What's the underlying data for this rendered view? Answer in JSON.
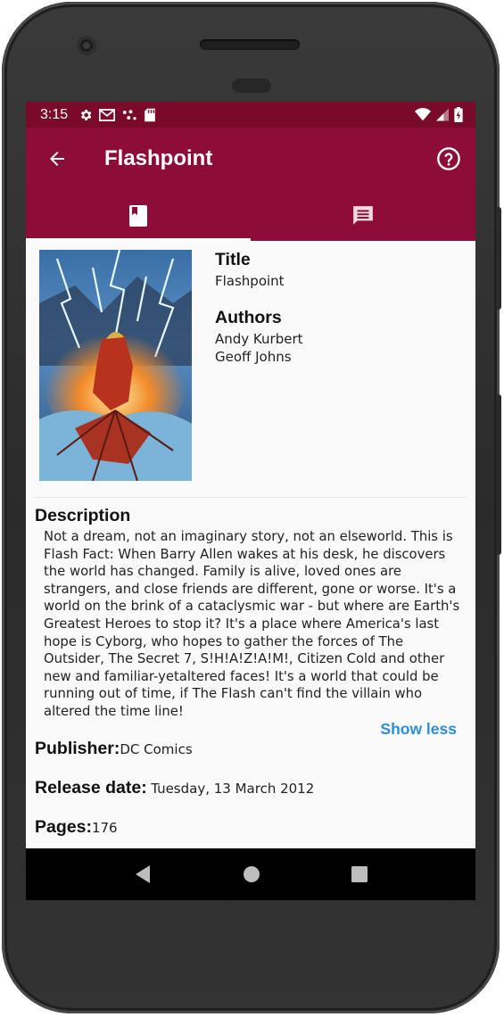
{
  "status_bar": {
    "time": "3:15"
  },
  "app_bar": {
    "title": "Flashpoint"
  },
  "tabs": [
    {
      "name": "details",
      "icon": "book-icon",
      "active": true
    },
    {
      "name": "comments",
      "icon": "comment-icon",
      "active": false
    }
  ],
  "book": {
    "title_label": "Title",
    "title": "Flashpoint",
    "authors_label": "Authors",
    "authors": [
      "Andy Kurbert",
      "Geoff Johns"
    ]
  },
  "description": {
    "label": "Description",
    "text": "Not a dream, not an imaginary story, not an elseworld. This is Flash Fact: When Barry Allen wakes at his desk, he discovers the world has changed. Family is alive, loved ones are strangers, and close friends are different, gone or worse. It's a world on the brink of a cataclysmic war - but where are Earth's Greatest Heroes to stop it? It's a place where America's last hope is Cyborg, who hopes to gather the forces of The Outsider, The Secret 7, S!H!A!Z!A!M!, Citizen Cold and other new and familiar-yetaltered faces! It's a world that could be running out of time, if The Flash can't find the villain who altered the time line!",
    "toggle": "Show less"
  },
  "details": {
    "publisher_label": "Publisher:",
    "publisher": "DC Comics",
    "release_label": "Release date:",
    "release": "Tuesday, 13 March 2012",
    "pages_label": "Pages:",
    "pages": "176"
  },
  "colors": {
    "primary": "#8e0c38",
    "status": "#7a0a2a",
    "accent": "#2a8ee0"
  }
}
